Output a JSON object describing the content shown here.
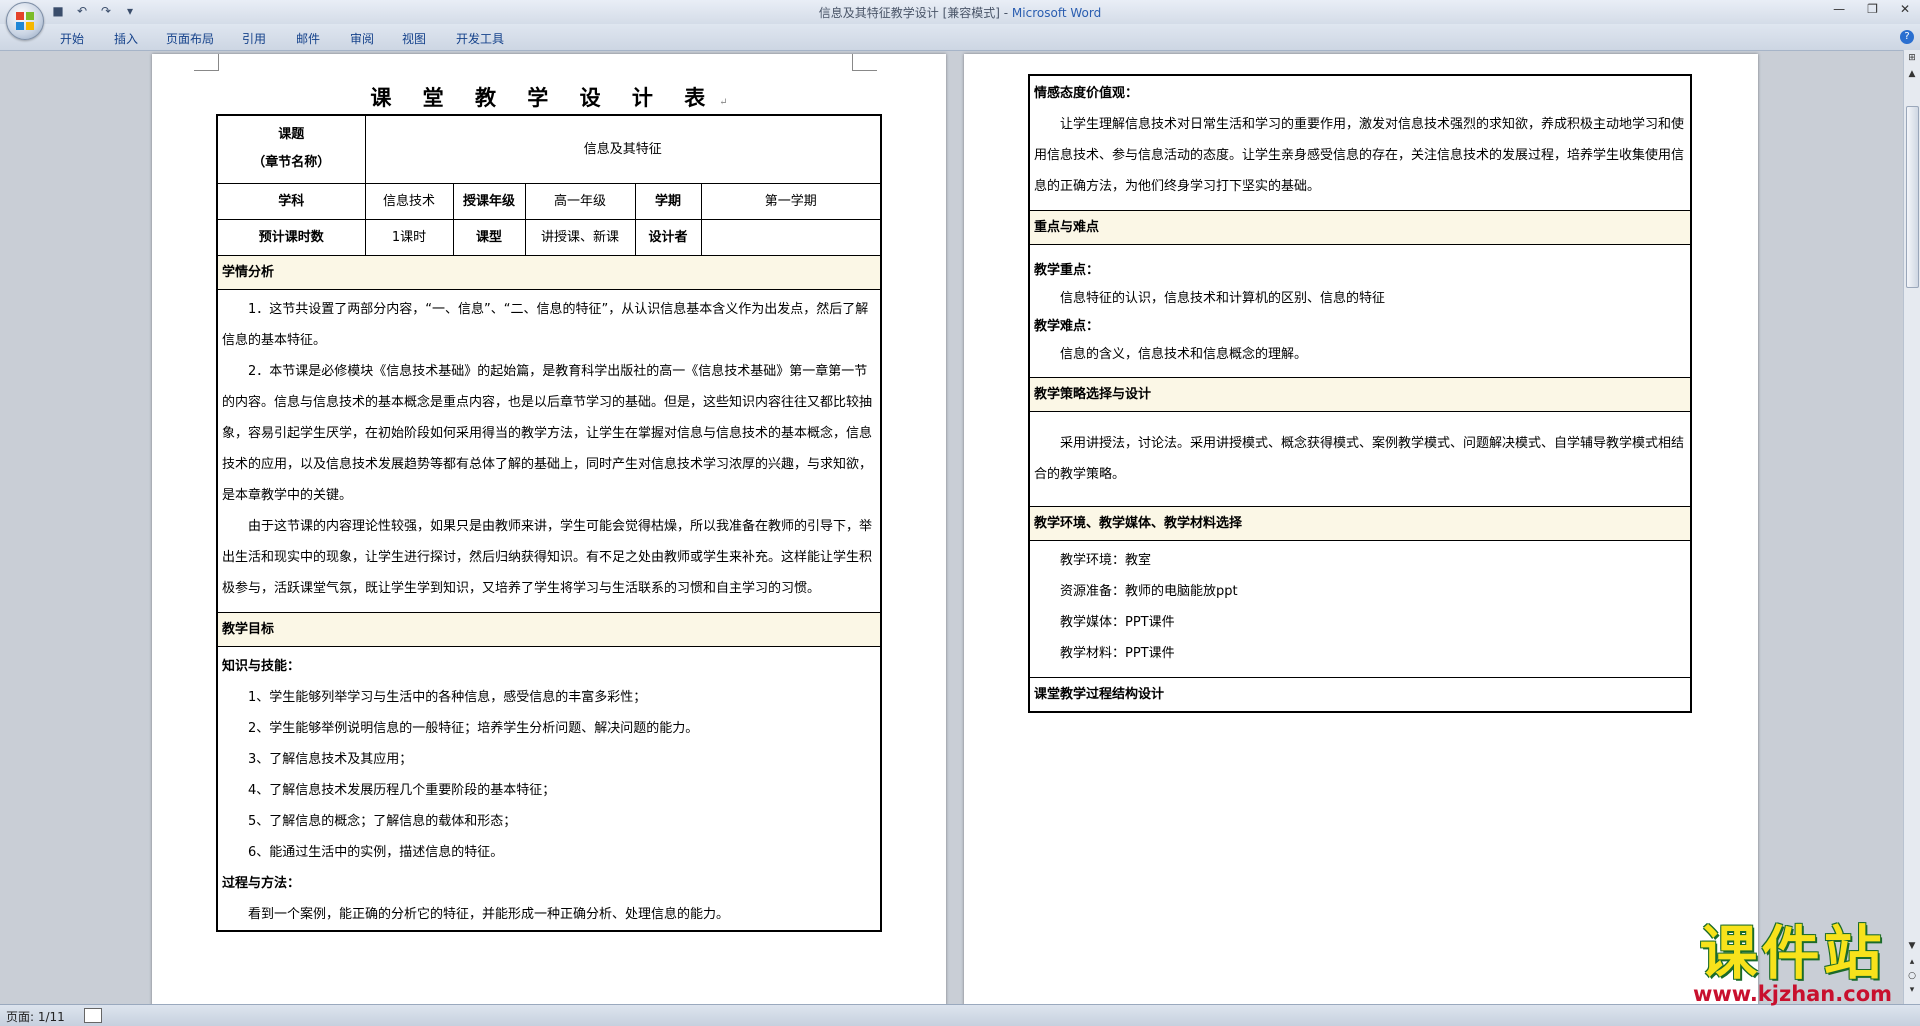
{
  "window": {
    "title_doc": "信息及其特征教学设计 [兼容模式] - ",
    "title_app": "Microsoft Word"
  },
  "ribbon": {
    "tabs": [
      "开始",
      "插入",
      "页面布局",
      "引用",
      "邮件",
      "审阅",
      "视图",
      "开发工具"
    ]
  },
  "page1": {
    "title": "课 堂 教 学 设 计 表",
    "header": {
      "topic_label_1": "课题",
      "topic_label_2": "（章节名称）",
      "topic_value": "信息及其特征",
      "subject_label": "学科",
      "subject_value": "信息技术",
      "grade_label": "授课年级",
      "grade_value": "高一年级",
      "term_label": "学期",
      "term_value": "第一学期",
      "hours_label": "预计课时数",
      "hours_value": "1课时",
      "type_label": "课型",
      "type_value": "讲授课、新课",
      "designer_label": "设计者",
      "designer_value": ""
    },
    "analysis": {
      "heading": "学情分析",
      "p1": "1．这节共设置了两部分内容，“一、信息”、“二、信息的特征”，从认识信息基本含义作为出发点，然后了解信息的基本特征。",
      "p2": "2．本节课是必修模块《信息技术基础》的起始篇，是教育科学出版社的高一《信息技术基础》第一章第一节的内容。信息与信息技术的基本概念是重点内容，也是以后章节学习的基础。但是，这些知识内容往往又都比较抽象，容易引起学生厌学，在初始阶段如何采用得当的教学方法，让学生在掌握对信息与信息技术的基本概念，信息技术的应用，以及信息技术发展趋势等都有总体了解的基础上，同时产生对信息技术学习浓厚的兴趣，与求知欲，是本章教学中的关键。",
      "p3": "由于这节课的内容理论性较强，如果只是由教师来讲，学生可能会觉得枯燥，所以我准备在教师的引导下，举出生活和现实中的现象，让学生进行探讨，然后归纳获得知识。有不足之处由教师或学生来补充。这样能让学生积极参与，活跃课堂气氛，既让学生学到知识，又培养了学生将学习与生活联系的习惯和自主学习的习惯。"
    },
    "objectives": {
      "heading": "教学目标",
      "knowledge_label": "知识与技能：",
      "items": [
        "1、学生能够列举学习与生活中的各种信息，感受信息的丰富多彩性；",
        "2、学生能够举例说明信息的一般特征；培养学生分析问题、解决问题的能力。",
        "3、了解信息技术及其应用；",
        "4、了解信息技术发展历程几个重要阶段的基本特征；",
        "5、了解信息的概念；了解信息的载体和形态；",
        "6、能通过生活中的实例，描述信息的特征。"
      ],
      "process_label": "过程与方法：",
      "process_text": "看到一个案例，能正确的分析它的特征，并能形成一种正确分析、处理信息的能力。"
    }
  },
  "page2": {
    "values": {
      "label": "情感态度价值观：",
      "text": "让学生理解信息技术对日常生活和学习的重要作用，激发对信息技术强烈的求知欲，养成积极主动地学习和使用信息技术、参与信息活动的态度。让学生亲身感受信息的存在，关注信息技术的发展过程，培养学生收集使用信息的正确方法，为他们终身学习打下坚实的基础。"
    },
    "keypoints": {
      "heading": "重点与难点",
      "key_label": "教学重点：",
      "key_text": "信息特征的认识，信息技术和计算机的区别、信息的特征",
      "diff_label": "教学难点：",
      "diff_text": "信息的含义，信息技术和信息概念的理解。"
    },
    "strategy": {
      "heading": "教学策略选择与设计",
      "text": "采用讲授法，讨论法。采用讲授模式、概念获得模式、案例教学模式、问题解决模式、自学辅导教学模式相结合的教学策略。"
    },
    "environment": {
      "heading": "教学环境、教学媒体、教学材料选择",
      "items": [
        "教学环境：教室",
        "资源准备：教师的电脑能放ppt",
        "教学媒体：PPT课件",
        "教学材料：PPT课件"
      ]
    },
    "process": {
      "heading": "课堂教学过程结构设计"
    }
  },
  "status": {
    "page": "页面: 1/11"
  },
  "watermark": {
    "main": "课件站",
    "url": "www.kjzhan.com"
  }
}
